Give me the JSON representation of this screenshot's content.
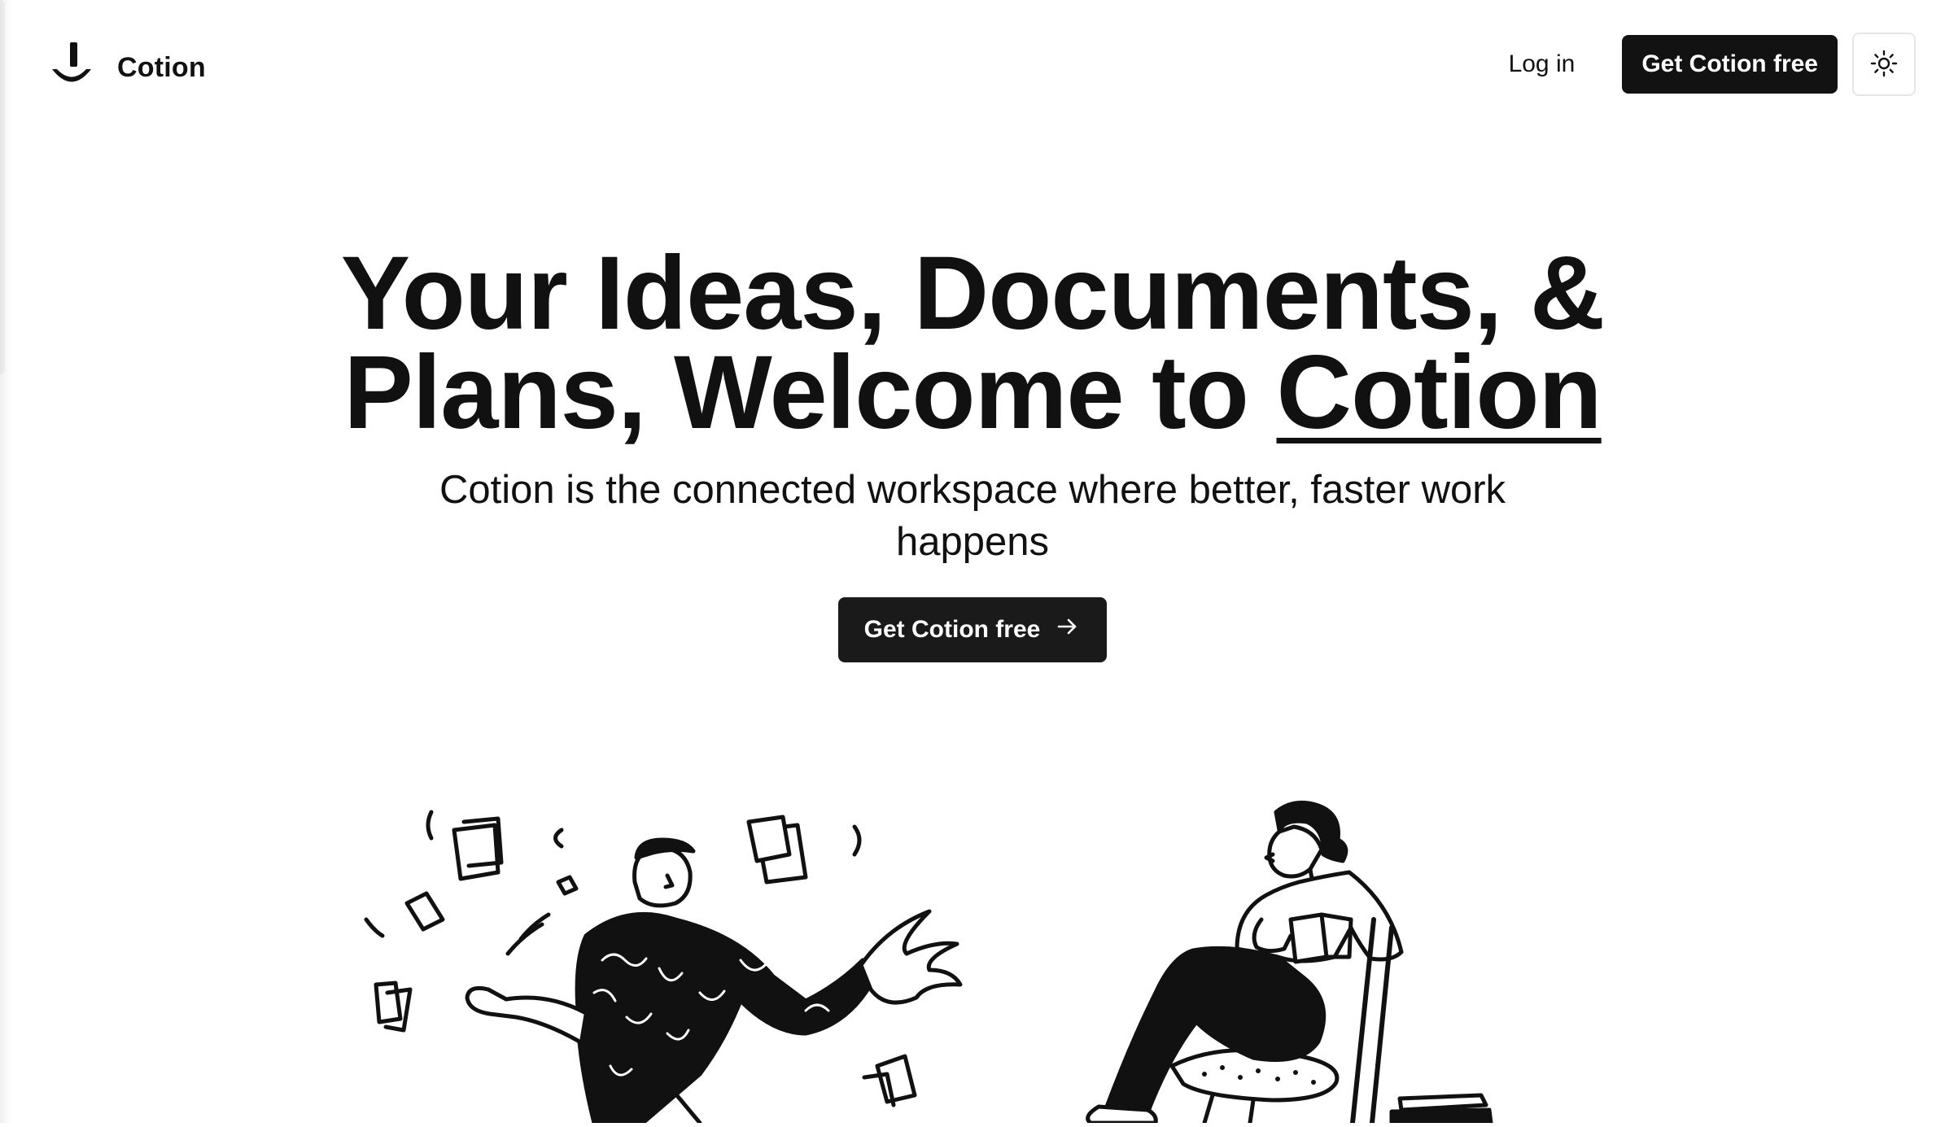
{
  "nav": {
    "brand_name": "Cotion",
    "login_label": "Log in",
    "cta_label": "Get Cotion free",
    "theme_toggle_icon": "sun-icon"
  },
  "hero": {
    "title_part1": "Your Ideas, Documents, & Plans, Welcome to",
    "title_highlight": "Cotion",
    "subtitle": "Cotion is the connected workspace where better, faster work happens",
    "cta_label": "Get Cotion free",
    "cta_icon": "arrow-right-icon"
  },
  "illustrations": {
    "left": "running-person-with-papers",
    "right": "seated-person-reading"
  },
  "colors": {
    "background": "#ffffff",
    "text": "#111111",
    "button_dark": "#121212",
    "border": "#e6e6e6"
  }
}
